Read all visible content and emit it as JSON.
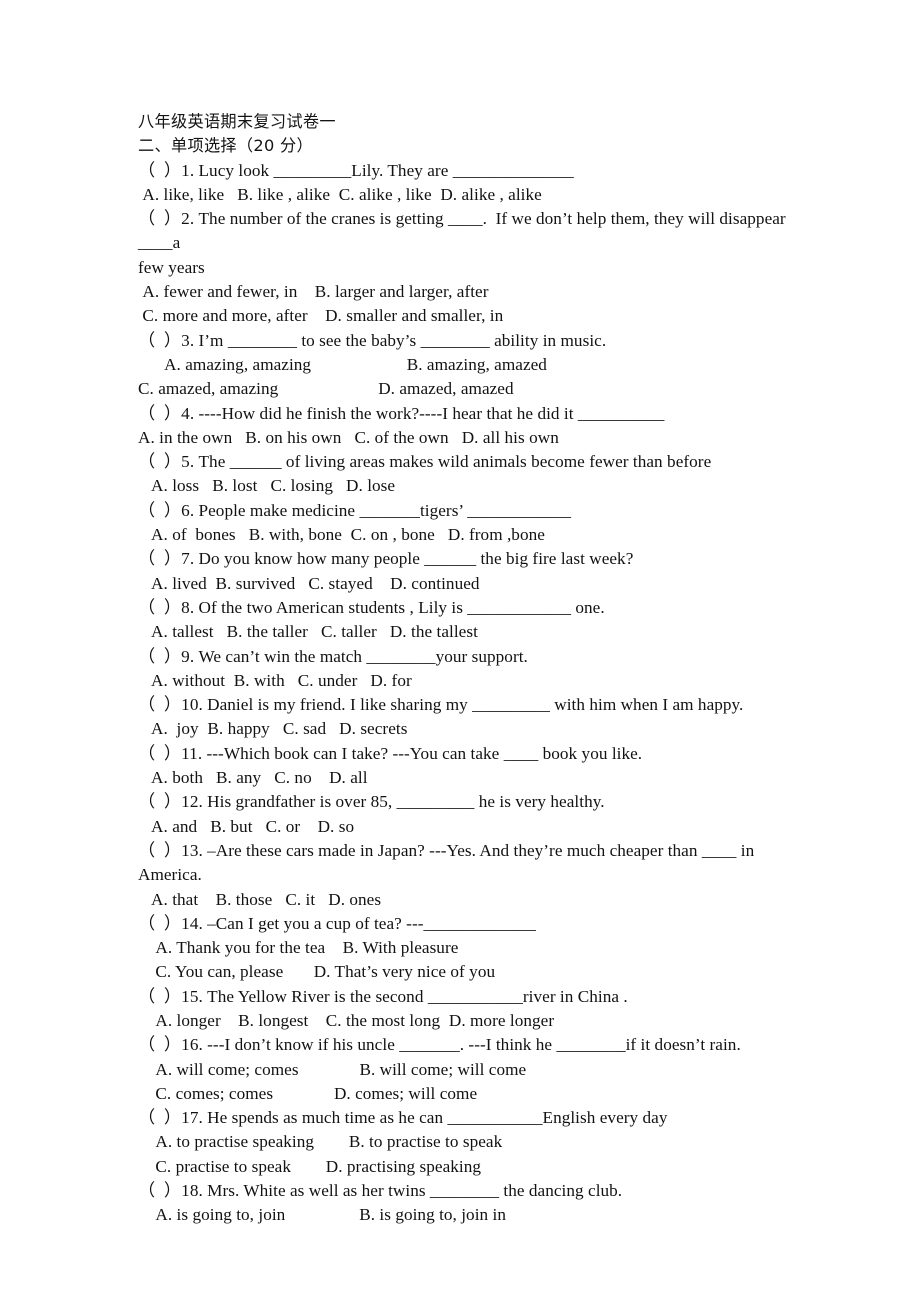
{
  "document": {
    "title_cn": "八年级英语期末复习试卷一",
    "section_heading_cn": "二、单项选择（20 分）",
    "lines": [
      {
        "text": "（  ）1. Lucy look _________Lily. They are ______________",
        "indent": "i0"
      },
      {
        "text": " A. like, like   B. like , alike  C. alike , like  D. alike , alike",
        "indent": "i0"
      },
      {
        "text": "（  ）2. The number of the cranes is getting ____.  If we don’t help them, they will disappear ____a",
        "indent": "i0"
      },
      {
        "text": "few years",
        "indent": "i0"
      },
      {
        "text": " A. fewer and fewer, in    B. larger and larger, after",
        "indent": "i0"
      },
      {
        "text": " C. more and more, after    D. smaller and smaller, in",
        "indent": "i0"
      },
      {
        "text": "（  ）3. I’m ________ to see the baby’s ________ ability in music.",
        "indent": "i0"
      },
      {
        "text": "      A. amazing, amazing                      B. amazing, amazed",
        "indent": "i0"
      },
      {
        "text": "C. amazed, amazing                       D. amazed, amazed",
        "indent": "i0"
      },
      {
        "text": "（  ）4. ----How did he finish the work?----I hear that he did it __________",
        "indent": "i0"
      },
      {
        "text": "A. in the own   B. on his own   C. of the own   D. all his own",
        "indent": "i0"
      },
      {
        "text": "（  ）5. The ______ of living areas makes wild animals become fewer than before",
        "indent": "i0"
      },
      {
        "text": "   A. loss   B. lost   C. losing   D. lose",
        "indent": "i0"
      },
      {
        "text": "（  ）6. People make medicine _______tigers’ ____________",
        "indent": "i0"
      },
      {
        "text": "   A. of  bones   B. with, bone  C. on , bone   D. from ,bone",
        "indent": "i0"
      },
      {
        "text": "（  ）7. Do you know how many people ______ the big fire last week?",
        "indent": "i0"
      },
      {
        "text": "   A. lived  B. survived   C. stayed    D. continued",
        "indent": "i0"
      },
      {
        "text": "（  ）8. Of the two American students , Lily is ____________ one.",
        "indent": "i0"
      },
      {
        "text": "   A. tallest   B. the taller   C. taller   D. the tallest",
        "indent": "i0"
      },
      {
        "text": "（  ）9. We can’t win the match ________your support.",
        "indent": "i0"
      },
      {
        "text": "   A. without  B. with   C. under   D. for",
        "indent": "i0"
      },
      {
        "text": "（  ）10. Daniel is my friend. I like sharing my _________ with him when I am happy.",
        "indent": "i0"
      },
      {
        "text": "   A.  joy  B. happy   C. sad   D. secrets",
        "indent": "i0"
      },
      {
        "text": "（  ）11. ---Which book can I take? ---You can take ____ book you like.",
        "indent": "i0"
      },
      {
        "text": "   A. both   B. any   C. no    D. all",
        "indent": "i0"
      },
      {
        "text": "（  ）12. His grandfather is over 85, _________ he is very healthy.",
        "indent": "i0"
      },
      {
        "text": "   A. and   B. but   C. or    D. so",
        "indent": "i0"
      },
      {
        "text": "（  ）13. –Are these cars made in Japan? ---Yes. And they’re much cheaper than ____ in America.",
        "indent": "i0"
      },
      {
        "text": "   A. that    B. those   C. it   D. ones",
        "indent": "i0"
      },
      {
        "text": "（  ）14. –Can I get you a cup of tea? ---_____________",
        "indent": "i0"
      },
      {
        "text": "    A. Thank you for the tea    B. With pleasure",
        "indent": "i0"
      },
      {
        "text": "    C. You can, please       D. That’s very nice of you",
        "indent": "i0"
      },
      {
        "text": "（  ）15. The Yellow River is the second ___________river in China .",
        "indent": "i0"
      },
      {
        "text": "    A. longer    B. longest    C. the most long  D. more longer",
        "indent": "i0"
      },
      {
        "text": "（  ）16. ---I don’t know if his uncle _______. ---I think he ________if it doesn’t rain.",
        "indent": "i0"
      },
      {
        "text": "    A. will come; comes              B. will come; will come",
        "indent": "i0"
      },
      {
        "text": "    C. comes; comes              D. comes; will come",
        "indent": "i0"
      },
      {
        "text": "（  ）17. He spends as much time as he can ___________English every day",
        "indent": "i0"
      },
      {
        "text": "    A. to practise speaking        B. to practise to speak",
        "indent": "i0"
      },
      {
        "text": "    C. practise to speak        D. practising speaking",
        "indent": "i0"
      },
      {
        "text": "（  ）18. Mrs. White as well as her twins ________ the dancing club.",
        "indent": "i0"
      },
      {
        "text": "    A. is going to, join                 B. is going to, join in",
        "indent": "i0"
      }
    ]
  }
}
